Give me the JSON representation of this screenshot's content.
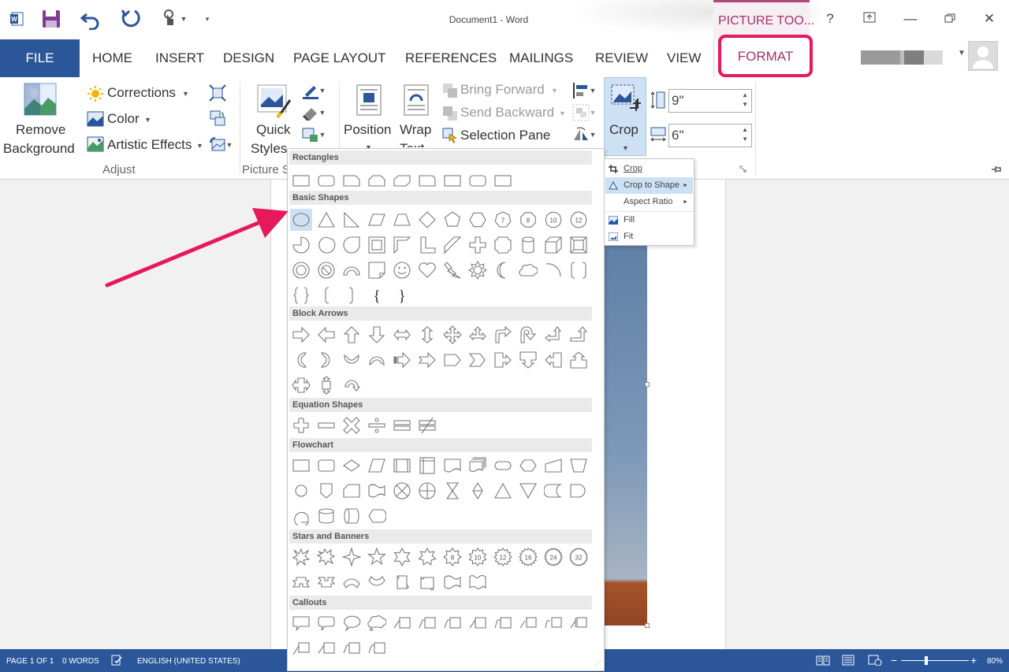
{
  "window": {
    "title": "Document1 - Word",
    "contextual_tab": "PICTURE TOO...",
    "help": "?",
    "minimize": "—",
    "close": "✕"
  },
  "tabs": {
    "file": "FILE",
    "home": "HOME",
    "insert": "INSERT",
    "design": "DESIGN",
    "page_layout": "PAGE LAYOUT",
    "references": "REFERENCES",
    "mailings": "MAILINGS",
    "review": "REVIEW",
    "view": "VIEW",
    "format": "FORMAT"
  },
  "ribbon": {
    "remove_bg_1": "Remove",
    "remove_bg_2": "Background",
    "corrections": "Corrections",
    "color": "Color",
    "artistic": "Artistic Effects",
    "adjust_label": "Adjust",
    "quick_1": "Quick",
    "quick_2": "Styles",
    "picture_styles_label": "Picture S",
    "position": "Position",
    "wrap_1": "Wrap",
    "wrap_2": "Text",
    "bring_forward": "Bring Forward",
    "send_backward": "Send Backward",
    "selection_pane": "Selection Pane",
    "crop": "Crop",
    "height_value": "9\"",
    "width_value": "6\""
  },
  "crop_menu": {
    "crop": "Crop",
    "crop_to_shape": "Crop to Shape",
    "aspect_ratio": "Aspect Ratio",
    "fill": "Fill",
    "fit": "Fit"
  },
  "shapes_menu": {
    "sections": {
      "rectangles": "Rectangles",
      "basic": "Basic Shapes",
      "block_arrows": "Block Arrows",
      "equation": "Equation Shapes",
      "flowchart": "Flowchart",
      "stars": "Stars and Banners",
      "callouts": "Callouts"
    },
    "labels": {
      "oct7": "7",
      "oct8": "8",
      "oct10": "10",
      "oct12": "12",
      "star8": "8",
      "star10": "10",
      "star12": "12",
      "star16": "16",
      "star24": "24",
      "star32": "32",
      "brace_left": "{",
      "brace_right": "}"
    }
  },
  "status": {
    "page": "PAGE 1 OF 1",
    "words": "0 WORDS",
    "language": "ENGLISH (UNITED STATES)",
    "zoom": "80%",
    "zoom_out": "−",
    "zoom_in": "+"
  },
  "colors": {
    "word_blue": "#2b579a",
    "picture_tools": "#a3356c",
    "highlight_pink": "#e6195d",
    "selection": "#cde0f4"
  }
}
